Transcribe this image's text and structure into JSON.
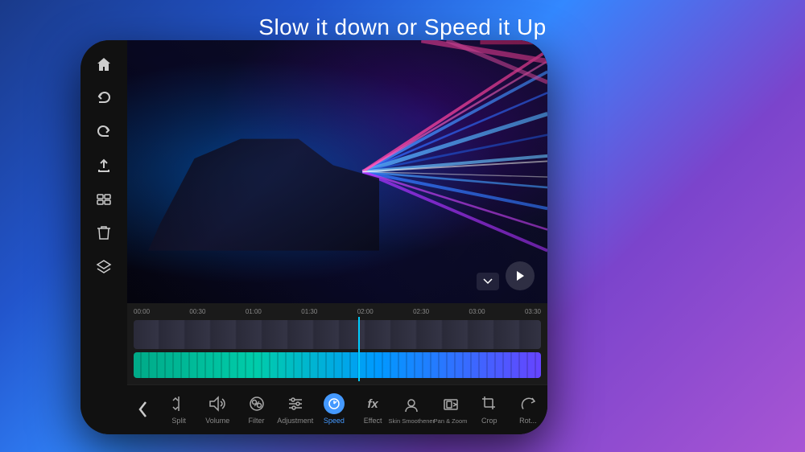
{
  "page": {
    "title": "Slow it down or Speed it Up",
    "background_gradient": "blue-purple"
  },
  "phone": {
    "sidebar_icons": [
      {
        "name": "home",
        "symbol": "⌂"
      },
      {
        "name": "undo",
        "symbol": "↩"
      },
      {
        "name": "redo",
        "symbol": "↪"
      },
      {
        "name": "export",
        "symbol": "⬆"
      },
      {
        "name": "gallery",
        "symbol": "▦"
      },
      {
        "name": "delete",
        "symbol": "🗑"
      },
      {
        "name": "layers",
        "symbol": "◫"
      }
    ]
  },
  "timeline": {
    "ruler_marks": [
      "00:00",
      "00:30",
      "01:00",
      "01:30",
      "02:00",
      "02:30",
      "03:00",
      "03:30"
    ]
  },
  "toolbar": {
    "back_label": "‹",
    "tools": [
      {
        "id": "split",
        "label": "Split",
        "icon": "scissors",
        "active": false
      },
      {
        "id": "volume",
        "label": "Volume",
        "icon": "volume",
        "active": false
      },
      {
        "id": "filter",
        "label": "Filter",
        "icon": "filter",
        "active": false
      },
      {
        "id": "adjustment",
        "label": "Adjustment",
        "icon": "sliders",
        "active": false
      },
      {
        "id": "speed",
        "label": "Speed",
        "icon": "speed",
        "active": true
      },
      {
        "id": "effect",
        "label": "Effect",
        "icon": "fx",
        "active": false
      },
      {
        "id": "skin",
        "label": "Skin Smoothener",
        "icon": "face",
        "active": false
      },
      {
        "id": "pan_zoom",
        "label": "Pan & Zoom",
        "icon": "pan",
        "active": false
      },
      {
        "id": "crop",
        "label": "Crop",
        "icon": "crop",
        "active": false
      },
      {
        "id": "rotate",
        "label": "Rot...",
        "icon": "rotate",
        "active": false
      }
    ]
  }
}
